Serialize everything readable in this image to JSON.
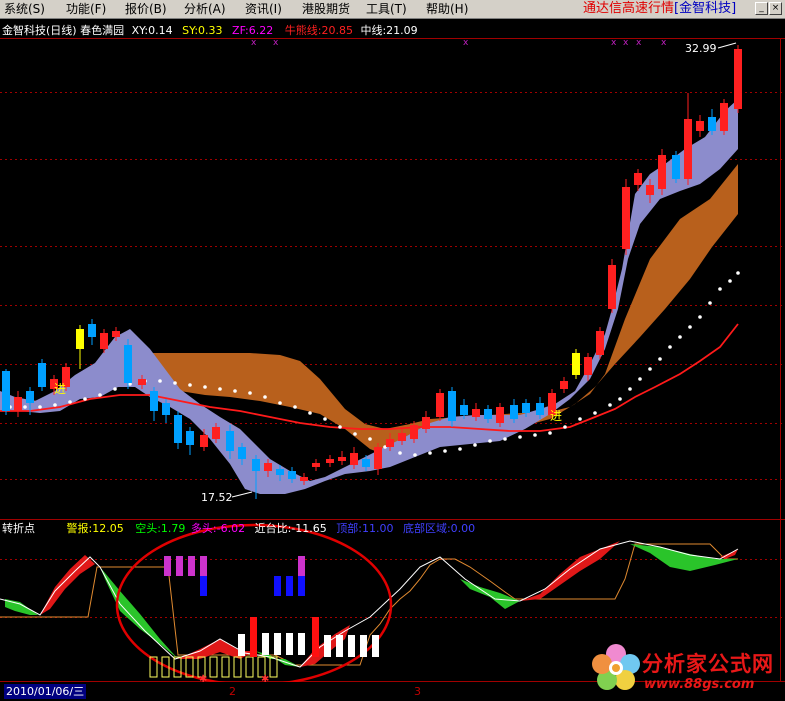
{
  "menubar": {
    "items": [
      "系统(S)",
      "功能(F)",
      "报价(B)",
      "分析(A)",
      "资讯(I)",
      "港股期货",
      "工具(T)",
      "帮助(H)"
    ],
    "brand_main": "通达信高速行情",
    "brand_sub": "[金智科技]",
    "minimize_icon": "minimize-icon",
    "close_icon": "close-icon"
  },
  "main_panel": {
    "title": "金智科技(日线) 春色满园",
    "indicators": [
      {
        "label": "XY:0.14",
        "color": "#ffffff"
      },
      {
        "label": "SY:0.33",
        "color": "#ffff00"
      },
      {
        "label": "ZF:6.22",
        "color": "#ff00ff"
      },
      {
        "label": "牛熊线:20.85",
        "color": "#ff2020"
      },
      {
        "label": "中线:21.09",
        "color": "#ffffff"
      }
    ],
    "price_high_label": "32.99",
    "price_low_label": "17.52",
    "entry_marks": [
      "进",
      "进"
    ]
  },
  "sub_panel": {
    "title": "转折点",
    "indicators": [
      {
        "label": "警报:12.05",
        "color": "#ffff00"
      },
      {
        "label": "空头:1.79",
        "color": "#00ff00"
      },
      {
        "label": "多头:-6.02",
        "color": "#ff00ff"
      },
      {
        "label": "近台比:-11.65",
        "color": "#ffffff"
      },
      {
        "label": "顶部:11.00",
        "color": "#4040ff"
      },
      {
        "label": "底部区域:0.00",
        "color": "#4040ff"
      }
    ]
  },
  "statusbar": {
    "date": "2010/01/06/三",
    "axis_marks": [
      "2",
      "3"
    ]
  },
  "watermark": {
    "name": "分析家公式网",
    "url": "www.88gs.com",
    "icon": "flower-logo-icon"
  },
  "colors": {
    "up_candle": "#ff2020",
    "down_candle": "#00a0ff",
    "band_lilac": "#8c8ccc",
    "band_brown": "#c06020",
    "ma_red": "#ff2020",
    "dot_white": "#ffffff",
    "grid": "#a00000"
  }
}
